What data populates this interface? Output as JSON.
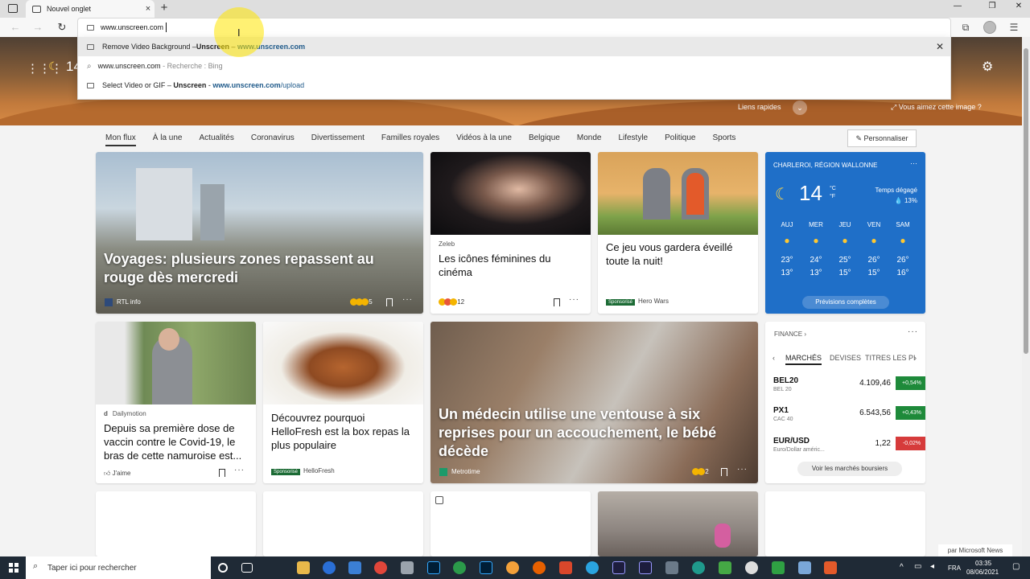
{
  "browser": {
    "tab_title": "Nouvel onglet",
    "tab_close": "×",
    "new_tab": "+",
    "window_controls": [
      "—",
      "❐",
      "✕"
    ],
    "nav": {
      "back": "←",
      "forward": "→",
      "reload": "↻"
    },
    "address_value": "www.unscreen.com",
    "right_icons": [
      "⧉",
      "☰"
    ]
  },
  "suggestions": [
    {
      "kind": "site",
      "title_pre": "Remove Video Background – ",
      "title_bold": "Unscreen",
      "sep": " – ",
      "domain_bold": "www.unscreen.com",
      "path": ""
    },
    {
      "kind": "search",
      "query": "www.unscreen.com",
      "hint": " - Recherche : Bing"
    },
    {
      "kind": "site",
      "title_pre": "Select Video or GIF – ",
      "title_bold": "Unscreen",
      "sep": " - ",
      "domain_bold": "www.unscreen.com",
      "path": "/upload"
    }
  ],
  "suggestion_close": "✕",
  "hero": {
    "apps_icon": "grid-icon",
    "temp": "14",
    "quick_links": "Liens rapides",
    "like_image": "Vous aimez cette image ?",
    "settings_icon": "gear-icon"
  },
  "categories": [
    "Mon flux",
    "À la une",
    "Actualités",
    "Coronavirus",
    "Divertissement",
    "Familles royales",
    "Vidéos à la une",
    "Belgique",
    "Monde",
    "Lifestyle",
    "Politique",
    "Sports"
  ],
  "personalize": "✎ Personnaliser",
  "cards": {
    "main": {
      "title": "Voyages: plusieurs zones repassent au rouge dès mercredi",
      "source": "RTL info",
      "reactions": "5"
    },
    "zeleb": {
      "source": "Zeleb",
      "title": "Les icônes féminines du cinéma",
      "reactions": "12"
    },
    "game": {
      "title": "Ce jeu vous gardera éveillé toute la nuit!",
      "sponsor": "Sponsorisé",
      "source": "Hero Wars"
    },
    "dailymotion": {
      "source": "Dailymotion",
      "title": "Depuis sa première dose de vaccin contre le Covid-19, le bras de cette namuroise est...",
      "like": "J'aime"
    },
    "hellofresh": {
      "title": "Découvrez pourquoi HelloFresh est la box repas la plus populaire",
      "sponsor": "Sponsorisé",
      "source": "HelloFresh"
    },
    "medecin": {
      "title": "Un médecin utilise une ventouse à six reprises pour un accouchement, le bébé décède",
      "source": "Metrotime",
      "reactions": "2"
    }
  },
  "weather": {
    "location": "CHARLEROI, RÉGION WALLONNE",
    "temp": "14",
    "unit_c": "°C",
    "unit_f": "°F",
    "condition": "Temps dégagé",
    "precip": "💧 13%",
    "days": [
      {
        "day": "AUJ",
        "hi": "23°",
        "lo": "13°"
      },
      {
        "day": "MER",
        "hi": "24°",
        "lo": "13°"
      },
      {
        "day": "JEU",
        "hi": "25°",
        "lo": "15°"
      },
      {
        "day": "VEN",
        "hi": "26°",
        "lo": "15°"
      },
      {
        "day": "SAM",
        "hi": "26°",
        "lo": "16°"
      }
    ],
    "forecast_button": "Prévisions complètes"
  },
  "finance": {
    "header": "FINANCE ›",
    "tabs": [
      "MARCHÉS",
      "DEVISES",
      "TITRES LES PI"
    ],
    "rows": [
      {
        "symbol": "BEL20",
        "name": "BEL 20",
        "value": "4.109,46",
        "change": "+0,54%",
        "color": "#1e8a3a"
      },
      {
        "symbol": "PX1",
        "name": "CAC 40",
        "value": "6.543,56",
        "change": "+0,43%",
        "color": "#1e8a3a"
      },
      {
        "symbol": "EUR/USD",
        "name": "Euro/Dollar améric...",
        "value": "1,22",
        "change": "-0,02%",
        "color": "#d63b3b"
      }
    ],
    "button": "Voir les marchés boursiers"
  },
  "msn_badge": "par Microsoft News",
  "taskbar": {
    "search_placeholder": "Taper ici pour rechercher",
    "lang": "FRA",
    "time": "03:35",
    "date": "08/06/2021"
  }
}
